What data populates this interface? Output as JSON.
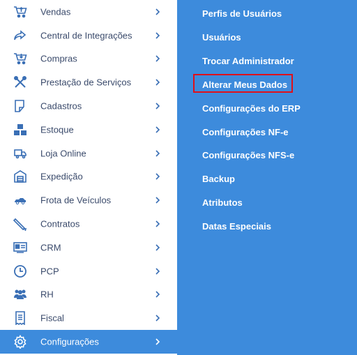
{
  "sidebar": {
    "items": [
      {
        "label": "Vendas",
        "icon": "cart-upload-icon"
      },
      {
        "label": "Central de Integrações",
        "icon": "share-arrow-icon"
      },
      {
        "label": "Compras",
        "icon": "cart-download-icon"
      },
      {
        "label": "Prestação de Serviços",
        "icon": "tools-icon"
      },
      {
        "label": "Cadastros",
        "icon": "edit-document-icon"
      },
      {
        "label": "Estoque",
        "icon": "boxes-icon"
      },
      {
        "label": "Loja Online",
        "icon": "delivery-truck-icon"
      },
      {
        "label": "Expedição",
        "icon": "warehouse-icon"
      },
      {
        "label": "Frota de Veículos",
        "icon": "car-icon"
      },
      {
        "label": "Contratos",
        "icon": "pen-icon"
      },
      {
        "label": "CRM",
        "icon": "id-card-icon"
      },
      {
        "label": "PCP",
        "icon": "clock-icon"
      },
      {
        "label": "RH",
        "icon": "users-icon"
      },
      {
        "label": "Fiscal",
        "icon": "receipt-icon"
      },
      {
        "label": "Configurações",
        "icon": "gear-icon",
        "active": true
      }
    ]
  },
  "submenu": {
    "items": [
      {
        "label": "Perfis de Usuários"
      },
      {
        "label": "Usuários"
      },
      {
        "label": "Trocar Administrador"
      },
      {
        "label": "Alterar Meus Dados",
        "highlighted": true
      },
      {
        "label": "Configurações do ERP"
      },
      {
        "label": "Configurações NF-e"
      },
      {
        "label": "Configurações NFS-e"
      },
      {
        "label": "Backup"
      },
      {
        "label": "Atributos"
      },
      {
        "label": "Datas Especiais"
      }
    ]
  },
  "colors": {
    "accent": "#3d8bdc",
    "icon": "#3a6fb5",
    "text": "#3a4a6b",
    "highlight": "#e0101a"
  }
}
